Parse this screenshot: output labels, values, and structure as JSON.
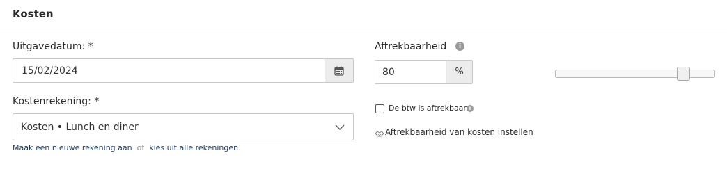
{
  "section": {
    "title": "Kosten"
  },
  "date": {
    "label": "Uitgavedatum: *",
    "value": "15/02/2024",
    "button_icon": "calendar-icon"
  },
  "account": {
    "label": "Kostenrekening: *",
    "selected": "Kosten • Lunch en diner",
    "chevron_icon": "chevron-down-icon",
    "new_account_link": "Maak een nieuwe rekening aan",
    "separator": "of",
    "choose_link": "kies uit alle rekeningen"
  },
  "deductibility": {
    "label": "Aftrekbaarheid",
    "info_icon": "info-icon",
    "value": "80",
    "unit": "%",
    "slider_value_percent": 80,
    "vat_checkbox_label": "De btw is aftrekbaar",
    "vat_checked": false,
    "settings_link": "Aftrekbaarheid van kosten instellen",
    "settings_icon": "handshake-icon"
  },
  "colors": {
    "text": "#2b2b2b",
    "link": "#1f3a5c",
    "border": "#c8c8c8",
    "addon_bg": "#ececec",
    "info_icon_bg": "#9a9a9a"
  }
}
